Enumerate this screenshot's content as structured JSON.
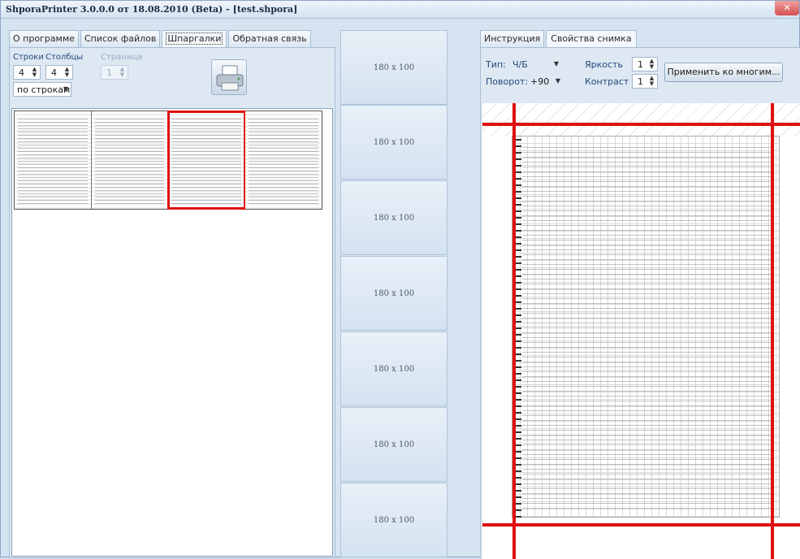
{
  "window": {
    "title": "ShporaPrinter 3.0.0.0 от 18.08.2010 (Beta) - [test.shpora]",
    "close_glyph": "✕"
  },
  "left_tabs": [
    {
      "label": "О программе"
    },
    {
      "label": "Список файлов"
    },
    {
      "label": "Шпаргалки"
    },
    {
      "label": "Обратная связь"
    }
  ],
  "controls": {
    "rows_label": "Строки",
    "rows_value": "4",
    "cols_label": "Столбцы",
    "cols_value": "4",
    "page_label": "Страница",
    "page_value": "1",
    "order_value": "по строкам"
  },
  "printer_icon": "printer-icon",
  "thumbnails": {
    "count": 4,
    "selected_index": 3
  },
  "slots": [
    {
      "label": "180 x 100"
    },
    {
      "label": "180 x 100"
    },
    {
      "label": "180 x 100"
    },
    {
      "label": "180 x 100"
    },
    {
      "label": "180 x 100"
    },
    {
      "label": "180 x 100"
    },
    {
      "label": "180 x 100"
    }
  ],
  "right_tabs": [
    {
      "label": "Инструкция"
    },
    {
      "label": "Свойства снимка"
    }
  ],
  "props": {
    "type_label": "Тип:",
    "type_value": "Ч/Б",
    "rotate_label": "Поворот:",
    "rotate_value": "+90",
    "brightness_label": "Яркость",
    "brightness_value": "1",
    "contrast_label": "Контраст",
    "contrast_value": "1",
    "apply_button": "Применить ко многим..."
  },
  "colors": {
    "accent_red": "#e01010",
    "window_bg": "#d6e4f2"
  }
}
